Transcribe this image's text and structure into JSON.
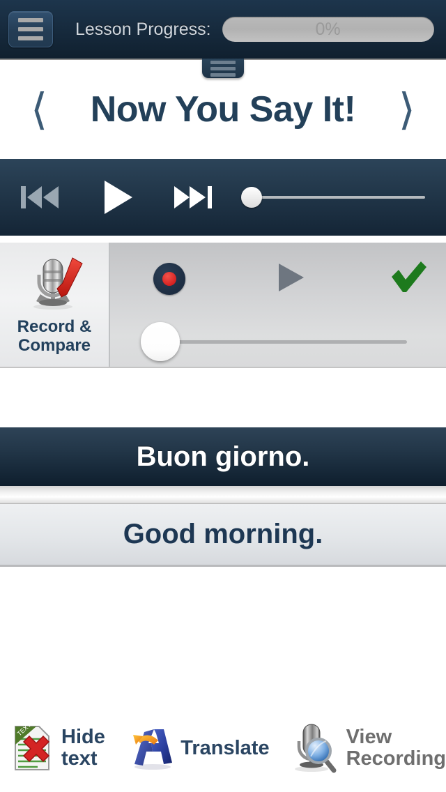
{
  "header": {
    "menu_icon": "hamburger-menu-icon",
    "progress_label": "Lesson Progress:",
    "progress_value": "0%",
    "progress_percent": 0,
    "tab_handle_icon": "drawer-handle-icon"
  },
  "title_bar": {
    "prev_icon": "chevron-left-icon",
    "next_icon": "chevron-right-icon",
    "title": "Now You Say It!"
  },
  "player": {
    "prev_icon": "skip-backward-icon",
    "play_icon": "play-icon",
    "next_icon": "skip-forward-icon",
    "seek_position_percent": 0
  },
  "record_compare": {
    "icon": "microphone-check-icon",
    "label_line1": "Record &",
    "label_line2": "Compare",
    "record_icon": "record-dot-icon",
    "play_icon": "play-triangle-icon",
    "accept_icon": "green-checkmark-icon",
    "slider_position_percent": 0
  },
  "phrases": {
    "target_language": "Buon giorno.",
    "native_language": "Good morning."
  },
  "toolbar": {
    "items": [
      {
        "icon": "document-x-icon",
        "label": "Hide text",
        "enabled": true
      },
      {
        "icon": "translate-letter-a-icon",
        "label": "Translate",
        "enabled": true
      },
      {
        "icon": "microphone-magnifier-icon",
        "label_line1": "View",
        "label_line2": "Recording",
        "enabled": false
      }
    ]
  },
  "colors": {
    "header_dark": "#10202f",
    "navy_accent": "#22405c",
    "record_red": "#d31f1f",
    "check_green": "#1d7a1d",
    "disabled_gray": "#6e6e6e"
  }
}
